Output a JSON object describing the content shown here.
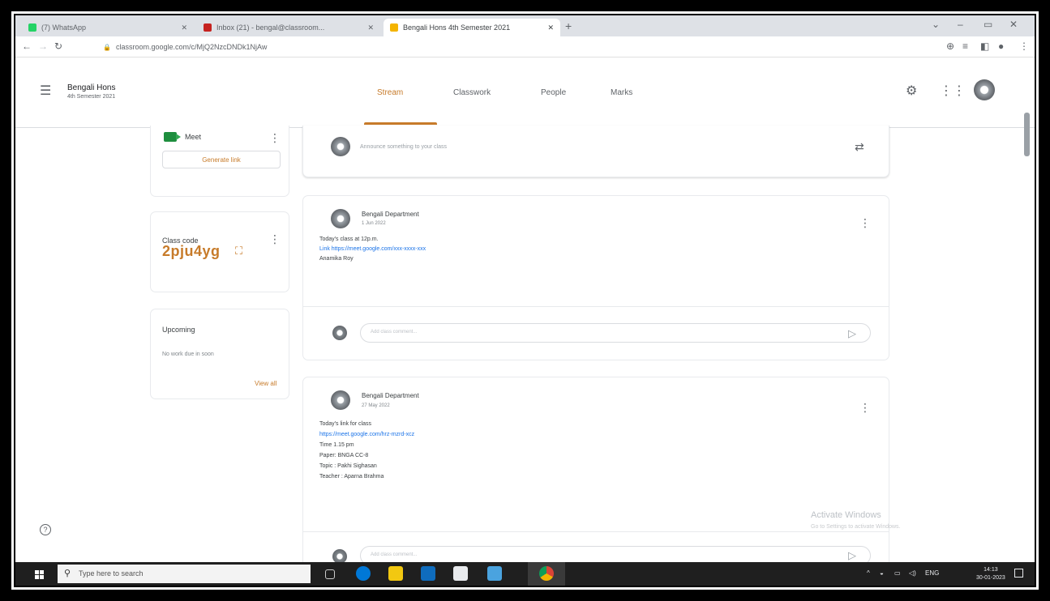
{
  "browser": {
    "tabs": [
      {
        "label": "(7) WhatsApp",
        "favicon_color": "#25d366"
      },
      {
        "label": "Inbox (21) - bengal@classroom...",
        "favicon_color": "#c5221f"
      },
      {
        "label": "Bengali Hons 4th Semester 2021",
        "favicon_color": "#f4b400"
      }
    ],
    "url": "classroom.google.com/c/MjQ2NzcDNDk1NjAw"
  },
  "classroom": {
    "class_name": "Bengali Hons",
    "class_subtitle": "4th Semester 2021",
    "nav": {
      "stream": "Stream",
      "classwork": "Classwork",
      "people": "People",
      "marks": "Marks"
    },
    "accent_color": "#c77b2a"
  },
  "sidebar": {
    "meet": {
      "title": "Meet",
      "button": "Generate link"
    },
    "class_code": {
      "title": "Class code",
      "code": "2pju4yg"
    },
    "upcoming": {
      "title": "Upcoming",
      "empty_text": "No work due in soon",
      "view_all": "View all"
    }
  },
  "stream": {
    "announce_placeholder": "Announce something to your class",
    "comment_placeholder": "Add class comment...",
    "posts": [
      {
        "author": "Bengali Department",
        "date": "1 Jun 2022",
        "lines": [
          "Today's class at 12p.m.",
          "Link https://meet.google.com/xxx-xxxx-xxx",
          "Anamika Roy"
        ]
      },
      {
        "author": "Bengali Department",
        "date": "27 May 2022",
        "lines": [
          "Today's link for class",
          "https://meet.google.com/hrz-mzrd-xcz",
          "Time 1.15 pm",
          "Paper: BNGA CC-8",
          "Topic : Pakhi Sighasan",
          "Teacher : Aparna Brahma"
        ]
      }
    ]
  },
  "watermark": {
    "title": "Activate Windows",
    "subtitle": "Go to Settings to activate Windows."
  },
  "taskbar": {
    "search_placeholder": "Type here to search",
    "tray_text": "ENG",
    "time": "14:13",
    "date": "30-01-2023"
  }
}
